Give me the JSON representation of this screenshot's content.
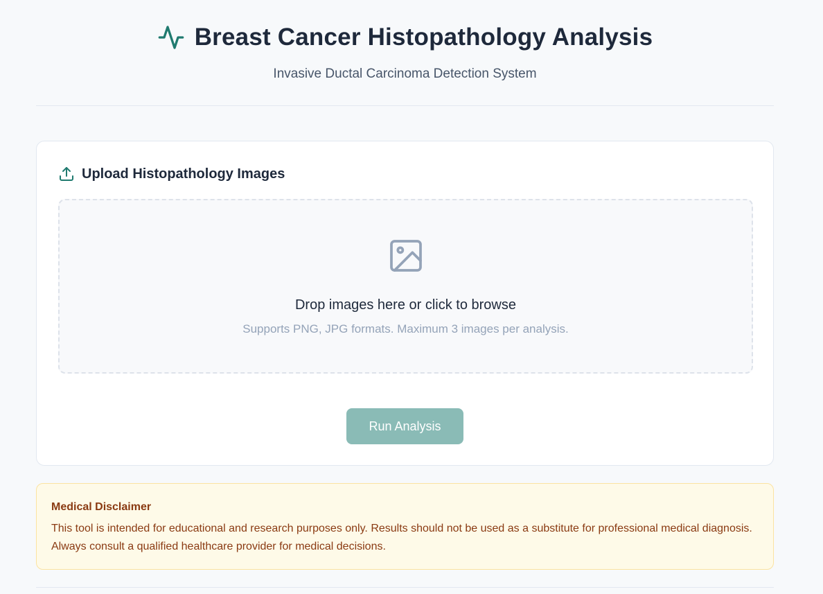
{
  "header": {
    "title": "Breast Cancer Histopathology Analysis",
    "subtitle": "Invasive Ductal Carcinoma Detection System",
    "icon": "activity-pulse-icon"
  },
  "upload": {
    "title": "Upload Histopathology Images",
    "icon": "upload-icon",
    "dropzone": {
      "icon": "image-icon",
      "title": "Drop images here or click to browse",
      "hint": "Supports PNG, JPG formats. Maximum 3 images per analysis."
    },
    "run_button_label": "Run Analysis",
    "run_button_state": "disabled"
  },
  "disclaimer": {
    "title": "Medical Disclaimer",
    "text": "This tool is intended for educational and research purposes only. Results should not be used as a substitute for professional medical diagnosis. Always consult a qualified healthcare provider for medical decisions."
  },
  "colors": {
    "accent": "#1f7a6f",
    "button_disabled": "#8abbb6",
    "disclaimer_bg": "#fefae8",
    "disclaimer_text": "#8a3a12"
  }
}
